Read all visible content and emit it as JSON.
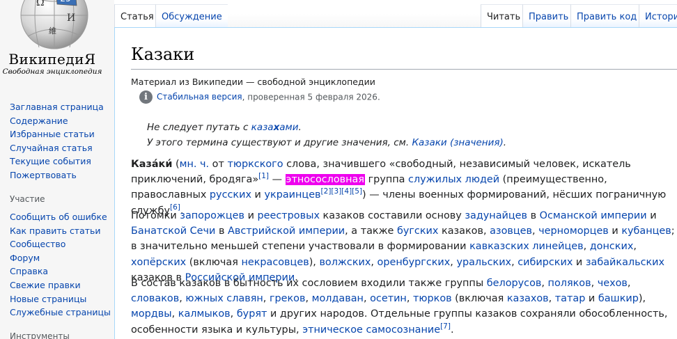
{
  "logo": {
    "wordmark": "ВикипедиЯ",
    "tagline": "Свободная энциклопедия",
    "globe_glyphs": [
      "Ω",
      "И",
      "維",
      "25"
    ]
  },
  "sidebar": {
    "nav": [
      "Заглавная страница",
      "Содержание",
      "Избранные статьи",
      "Случайная статья",
      "Текущие события",
      "Пожертвовать"
    ],
    "participation_heading": "Участие",
    "participation": [
      "Сообщить об ошибке",
      "Как править статьи",
      "Сообщество",
      "Форум",
      "Справка",
      "Свежие правки",
      "Новые страницы",
      "Служебные страницы"
    ],
    "tools_heading": "Инструменты"
  },
  "tabs": {
    "article": "Статья",
    "talk": "Обсуждение",
    "read": "Читать",
    "edit": "Править",
    "edit_source": "Править код",
    "history": "Истори"
  },
  "article": {
    "title": "Казаки",
    "tagline": "Материал из Википедии — свободной энциклопедии",
    "stable_link": "Стабильная версия",
    "stable_rest": ", проверенная 5 февраля 2026.",
    "hatnote1": {
      "pre": "Не следует путать с ",
      "link_a": "каза",
      "link_b": "х",
      "link_c": "ами",
      "post": "."
    },
    "hatnote2": {
      "pre": "У этого термина существуют и другие значения, см. ",
      "link": "Казаки (значения)",
      "post": "."
    },
    "p1": {
      "bold": "Каза́ки́",
      "t1": " (",
      "l_mnch": "мн. ч.",
      "t2": " от ",
      "l_turk": "тюркского",
      "t3": " слова, значившего «свободный, независимый человек, искатель приключений, бродяга»",
      "r1": "[1]",
      "t4": " — ",
      "hl": "этносословная",
      "t5": " группа ",
      "l_sluz": "служилых людей",
      "t6": " (преимущественно, православных ",
      "l_rus": "русских",
      "t7": " и ",
      "l_ukr": "украинцев",
      "r2": "[2]",
      "r3": "[3]",
      "r4": "[4]",
      "r5": "[5]",
      "t8": ") — члены военных формирований, нёсших пограничную службу",
      "r6": "[6]",
      "t9": "."
    },
    "p2": {
      "t1": "Потомки ",
      "l_zap": "запорожцев",
      "t2": " и ",
      "l_reestr": "реестровых",
      "t3": " казаков составили основу ",
      "l_zadun": "задунайцев",
      "t4": " в ",
      "l_osm": "Османской империи",
      "t5": " и ",
      "l_banat": "Банатской Сечи",
      "t6": " в ",
      "l_avstr": "Австрийской империи",
      "t7": ", а также ",
      "l_bug": "бугских",
      "t8": " казаков, ",
      "l_azov": "азовцев",
      "t9": ", ",
      "l_chern": "черноморцев",
      "t10": " и ",
      "l_kuban": "кубанцев",
      "t11": "; в значительно меньшей степени участвовали в формировании ",
      "l_kavk": "кавказских линейцев",
      "t12": ", ",
      "l_don": "донских",
      "t13": ", ",
      "l_hoper": "хопёрских",
      "t14": " (включая ",
      "l_nekr": "некрасовцев",
      "t15": "), ",
      "l_volzh": "волжских",
      "t16": ", ",
      "l_orenb": "оренбургских",
      "t17": ", ",
      "l_ural": "уральских",
      "t18": ", ",
      "l_sib": "сибирских",
      "t19": " и ",
      "l_zabaik": "забайкальских",
      "t20": " казаков в ",
      "l_rimp": "Российской империи",
      "t21": "."
    },
    "p3": {
      "t1": "В состав казаков в бытность их сословием входили также группы ",
      "l_bel": "белорусов",
      "t2": ", ",
      "l_pol": "поляков",
      "t3": ", ",
      "l_cheh": "чехов",
      "t4": ", ",
      "l_slov": "словаков",
      "t5": ", ",
      "l_yuzh": "южных славян",
      "t6": ", ",
      "l_grek": "греков",
      "t7": ", ",
      "l_mold": "молдаван",
      "t8": ", ",
      "l_oset": "осетин",
      "t9": ", ",
      "l_turk": "тюрков",
      "t10": " (включая ",
      "l_kaz": "казахов",
      "t11": ", ",
      "l_tat": "татар",
      "t12": " и ",
      "l_bash": "башкир",
      "t13": "), ",
      "l_mord": "мордвы",
      "t14": ", ",
      "l_kalm": "калмыков",
      "t15": ", ",
      "l_bur": "бурят",
      "t16": " и других народов. Отдельные группы казаков сохраняли обособленность, особенности языка и культуры, ",
      "l_etn": "этническое самосознание",
      "r7": "[7]",
      "t17": "."
    }
  }
}
